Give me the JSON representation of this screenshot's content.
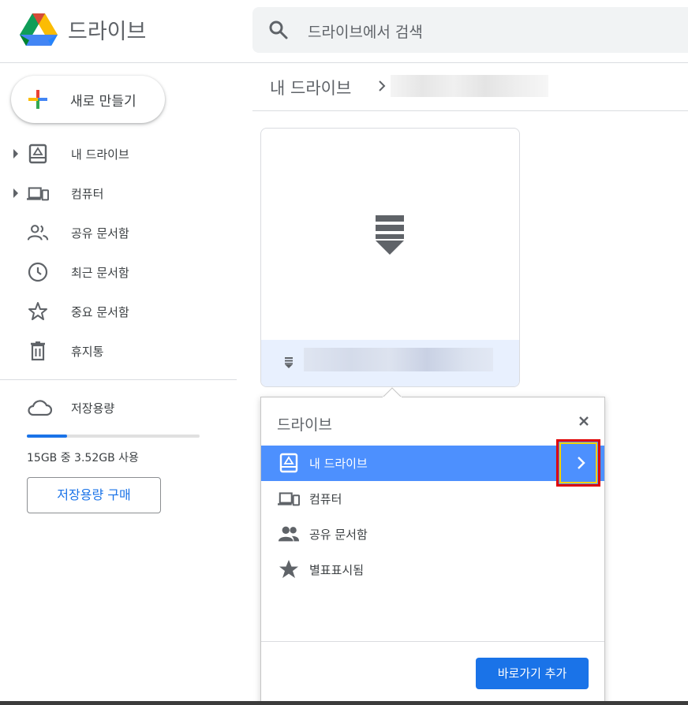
{
  "header": {
    "app_title": "드라이브",
    "search_placeholder": "드라이브에서 검색"
  },
  "sidebar": {
    "new_button": "새로 만들기",
    "items": [
      {
        "label": "내 드라이브",
        "icon": "my-drive-icon",
        "has_caret": true
      },
      {
        "label": "컴퓨터",
        "icon": "computer-icon",
        "has_caret": true
      },
      {
        "label": "공유 문서함",
        "icon": "people-icon",
        "has_caret": false
      },
      {
        "label": "최근 문서함",
        "icon": "clock-icon",
        "has_caret": false
      },
      {
        "label": "중요 문서함",
        "icon": "star-icon",
        "has_caret": false
      },
      {
        "label": "휴지통",
        "icon": "trash-icon",
        "has_caret": false
      }
    ],
    "storage": {
      "label": "저장용량",
      "usage_text": "15GB 중 3.52GB 사용",
      "used_fraction": 0.235,
      "buy_button": "저장용량 구매"
    }
  },
  "main": {
    "breadcrumb_root": "내 드라이브"
  },
  "dialog": {
    "title": "드라이브",
    "items": [
      {
        "label": "내 드라이브",
        "icon": "my-drive-icon",
        "selected": true
      },
      {
        "label": "컴퓨터",
        "icon": "computer-icon",
        "selected": false
      },
      {
        "label": "공유 문서함",
        "icon": "people-icon",
        "selected": false
      },
      {
        "label": "별표표시됨",
        "icon": "star-icon",
        "selected": false
      }
    ],
    "add_shortcut_button": "바로가기 추가"
  },
  "colors": {
    "accent": "#1a73e8",
    "selected_row": "#4d90fe",
    "highlight_border": "#e00000",
    "highlight_inner": "#f7d200"
  }
}
